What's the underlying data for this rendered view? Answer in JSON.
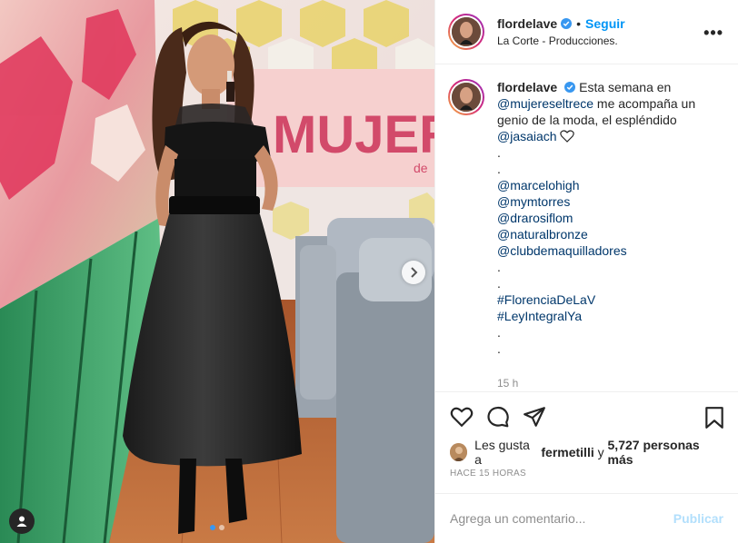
{
  "post": {
    "username": "flordelave",
    "follow_label": "Seguir",
    "bullet": "•",
    "location": "La Corte - Producciones.",
    "more_label": "•••"
  },
  "caption": {
    "username": "flordelave",
    "text_1": "Esta semana en",
    "mention_1": "@mujereseltrece",
    "text_2": "me acompaña un genio de la moda, el espléndido",
    "mention_2": "@jasaiach",
    "dot": ".",
    "mentions": [
      "@marcelohigh",
      "@mymtorres",
      "@drarosiflom",
      "@naturalbronze",
      "@clubdemaquilladores"
    ],
    "hashtags": [
      "#FlorenciaDeLaV",
      "#LeyIntegralYa"
    ],
    "time": "15 h"
  },
  "likes": {
    "prefix": "Les gusta a",
    "liker": "fermetilli",
    "joiner": "y",
    "others": "5,727 personas más"
  },
  "posted_ago": "HACE 15 HORAS",
  "comment_box": {
    "placeholder": "Agrega un comentario...",
    "post_label": "Publicar"
  },
  "carousel": {
    "count": 2,
    "active": 0
  },
  "colors": {
    "accent": "#0095f6",
    "link": "#00376b",
    "muted": "#8e8e8e",
    "publish_disabled": "#b2dffc"
  },
  "icons": {
    "verified": "verified-badge-icon",
    "like": "heart-icon",
    "comment": "comment-bubble-icon",
    "share": "paper-plane-icon",
    "save": "bookmark-icon",
    "next": "chevron-right-icon",
    "user_tags": "user-tag-icon",
    "caption_heart": "white-heart-icon"
  }
}
